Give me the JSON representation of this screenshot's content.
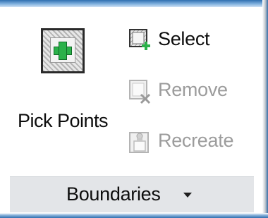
{
  "panel": {
    "title": "Boundaries",
    "dropdown_icon": "caret-down-icon"
  },
  "buttons": {
    "pick_points": {
      "label": "Pick Points",
      "icon": "pick-points-icon",
      "enabled": true
    },
    "select": {
      "label": "Select",
      "icon": "select-objects-icon",
      "enabled": true
    },
    "remove": {
      "label": "Remove",
      "icon": "remove-boundary-icon",
      "enabled": false
    },
    "recreate": {
      "label": "Recreate",
      "icon": "recreate-boundary-icon",
      "enabled": false
    }
  },
  "colors": {
    "accent_blue": "#2f6fb0",
    "plus_green": "#2bb14a",
    "disabled_text": "#9c9c9c",
    "title_bar": "#e3e5e8"
  }
}
